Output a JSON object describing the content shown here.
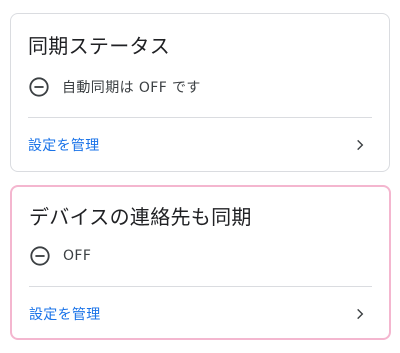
{
  "cards": [
    {
      "title": "同期ステータス",
      "status_icon": "remove-circle-icon",
      "status_text": "自動同期は OFF です",
      "manage_link": "設定を管理",
      "chevron_icon": "chevron-right-icon"
    },
    {
      "title": "デバイスの連絡先も同期",
      "status_icon": "remove-circle-icon",
      "status_text": "OFF",
      "manage_link": "設定を管理",
      "chevron_icon": "chevron-right-icon"
    }
  ],
  "colors": {
    "link": "#1a73e8",
    "title": "#202124",
    "border": "#dadce0",
    "highlight_border": "#f4b6cf"
  }
}
